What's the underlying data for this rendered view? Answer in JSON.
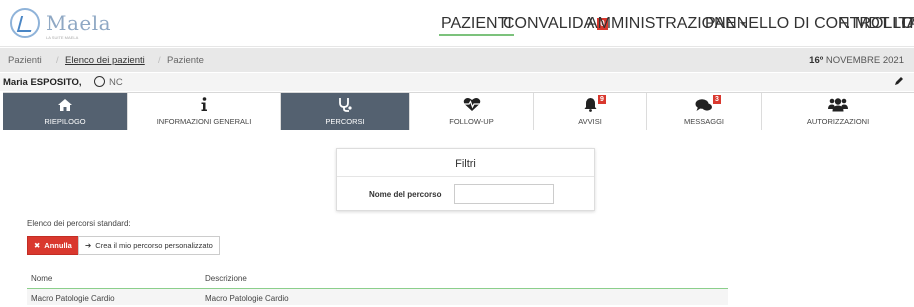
{
  "brand": {
    "name": "Maela",
    "tagline": "LA SUITE MAELA"
  },
  "nav": {
    "pazienti": "PAZIENTI",
    "convalida": "CONVALIDA",
    "convalida_count": "0",
    "amministrazione": "AMMINISTRAZIONE",
    "pannello": "PANNELLO DI CONTROLLO",
    "user": "F. MDT ITA",
    "lang": "IT"
  },
  "breadcrumb": {
    "items": [
      "Pazienti",
      "Elenco dei pazienti",
      "Paziente"
    ],
    "separator": "/",
    "date_day": "16º",
    "date_rest": " NOVEMBRE 2021"
  },
  "patient": {
    "name": "Maria ESPOSITO,",
    "sex": "NC"
  },
  "tabs": [
    {
      "label": "RIEPILOGO",
      "icon": "home-icon"
    },
    {
      "label": "INFORMAZIONI GENERALI",
      "icon": "info-icon"
    },
    {
      "label": "PERCORSI",
      "icon": "stethoscope-icon"
    },
    {
      "label": "FOLLOW-UP",
      "icon": "heartbeat-icon"
    },
    {
      "label": "AVVISI",
      "icon": "bell-icon",
      "badge": "9"
    },
    {
      "label": "MESSAGGI",
      "icon": "comments-icon",
      "badge": "3"
    },
    {
      "label": "AUTORIZZAZIONI",
      "icon": "users-icon"
    }
  ],
  "filters": {
    "title": "Filtri",
    "field_label": "Nome del percorso",
    "field_value": "",
    "field_placeholder": ""
  },
  "standard_label": "Elenco dei percorsi standard:",
  "buttons": {
    "cancel": "Annulla",
    "custom": "Crea il mio percorso personalizzato"
  },
  "table": {
    "columns": [
      "Nome",
      "Descrizione"
    ],
    "rows": [
      {
        "nome": "Macro Patologie Cardio",
        "descrizione": "Macro Patologie Cardio"
      }
    ]
  },
  "colors": {
    "accent_green": "#7cc27c",
    "badge_red": "#d9382e",
    "tab_active": "#546170"
  }
}
